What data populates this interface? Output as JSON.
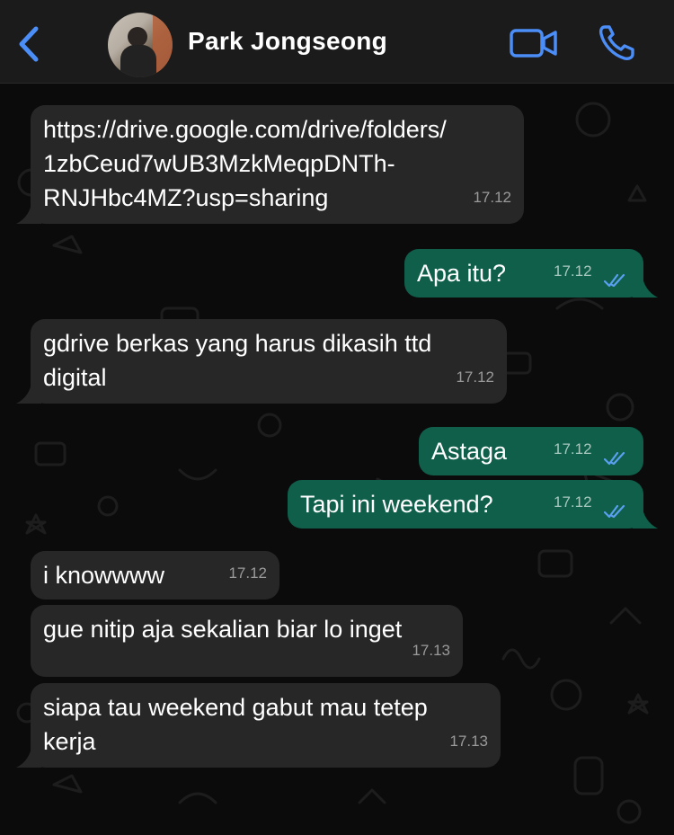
{
  "header": {
    "back_icon": "chevron-left-icon",
    "contact_name": "Park Jongseong",
    "video_icon": "video-camera-icon",
    "phone_icon": "phone-icon",
    "accent_color": "#4c8ef7"
  },
  "messages": [
    {
      "direction": "in",
      "lines": [
        "https://drive.google.com/drive/folders/",
        "1zbCeud7wUB3MzkMeqpDNTh-",
        "RNJHbc4MZ?usp=sharing"
      ],
      "time": "17.12"
    },
    {
      "direction": "out",
      "lines": [
        "Apa itu?"
      ],
      "time": "17.12",
      "status": "read"
    },
    {
      "direction": "in",
      "lines": [
        "gdrive berkas yang harus dikasih ttd",
        "digital"
      ],
      "time": "17.12"
    },
    {
      "direction": "out",
      "lines": [
        "Astaga"
      ],
      "time": "17.12",
      "status": "read"
    },
    {
      "direction": "out",
      "lines": [
        "Tapi ini weekend?"
      ],
      "time": "17.12",
      "status": "read"
    },
    {
      "direction": "in",
      "lines": [
        "i knowwww"
      ],
      "time": "17.12"
    },
    {
      "direction": "in",
      "lines": [
        "gue nitip aja sekalian biar lo inget"
      ],
      "time": "17.13"
    },
    {
      "direction": "in",
      "lines": [
        "siapa tau weekend gabut mau tetep",
        "kerja"
      ],
      "time": "17.13"
    }
  ],
  "colors": {
    "incoming_bubble": "#272727",
    "outgoing_bubble": "#0f5f4b",
    "read_ticks": "#5aa0f0"
  }
}
